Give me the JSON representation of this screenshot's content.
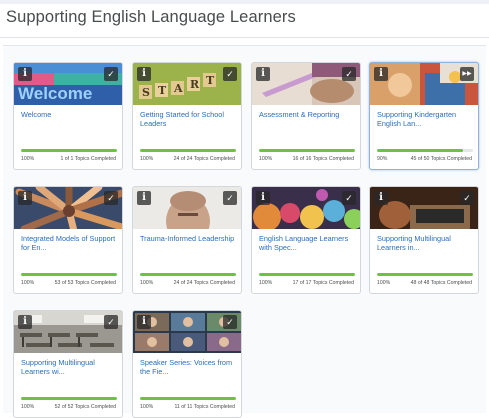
{
  "page": {
    "title": "Supporting English Language Learners"
  },
  "icons": {
    "info": "info-icon",
    "complete": "checkmark-icon",
    "in_progress": "fast-forward-icon"
  },
  "colors": {
    "title_link": "#2a6ebb",
    "progress": "#6bc43f",
    "track": "#e4e6e9"
  },
  "cards": [
    {
      "title": "Welcome",
      "percent_label": "100%",
      "progress": 1.0,
      "topics": "1 of 1 Topics Completed",
      "status": "complete",
      "status_glyph": "✓",
      "selected": false
    },
    {
      "title": "Getting Started for School Leaders",
      "percent_label": "100%",
      "progress": 1.0,
      "topics": "24 of 24 Topics Completed",
      "status": "complete",
      "status_glyph": "✓",
      "selected": false
    },
    {
      "title": "Assessment & Reporting",
      "percent_label": "100%",
      "progress": 1.0,
      "topics": "16 of 16 Topics Completed",
      "status": "complete",
      "status_glyph": "✓",
      "selected": false
    },
    {
      "title": "Supporting Kindergarten English Lan...",
      "percent_label": "90%",
      "progress": 0.9,
      "topics": "45 of 50 Topics Completed",
      "status": "in-progress",
      "status_glyph": "▶▶",
      "selected": true
    },
    {
      "title": "Integrated Models of Support for En...",
      "percent_label": "100%",
      "progress": 1.0,
      "topics": "53 of 53 Topics Completed",
      "status": "complete",
      "status_glyph": "✓",
      "selected": false
    },
    {
      "title": "Trauma-Informed Leadership",
      "percent_label": "100%",
      "progress": 1.0,
      "topics": "24 of 24 Topics Completed",
      "status": "complete",
      "status_glyph": "✓",
      "selected": false
    },
    {
      "title": "English Language Learners with Spec...",
      "percent_label": "100%",
      "progress": 1.0,
      "topics": "17 of 17 Topics Completed",
      "status": "complete",
      "status_glyph": "✓",
      "selected": false
    },
    {
      "title": "Supporting Multilingual Learners in...",
      "percent_label": "100%",
      "progress": 1.0,
      "topics": "48 of 48 Topics Completed",
      "status": "complete",
      "status_glyph": "✓",
      "selected": false
    },
    {
      "title": "Supporting Multilingual Learners wi...",
      "percent_label": "100%",
      "progress": 1.0,
      "topics": "52 of 52 Topics Completed",
      "status": "complete",
      "status_glyph": "✓",
      "selected": false
    },
    {
      "title": "Speaker Series: Voices from the Fie...",
      "percent_label": "100%",
      "progress": 1.0,
      "topics": "11 of 11 Topics Completed",
      "status": "complete",
      "status_glyph": "✓",
      "selected": false
    }
  ],
  "info_glyph": "i"
}
